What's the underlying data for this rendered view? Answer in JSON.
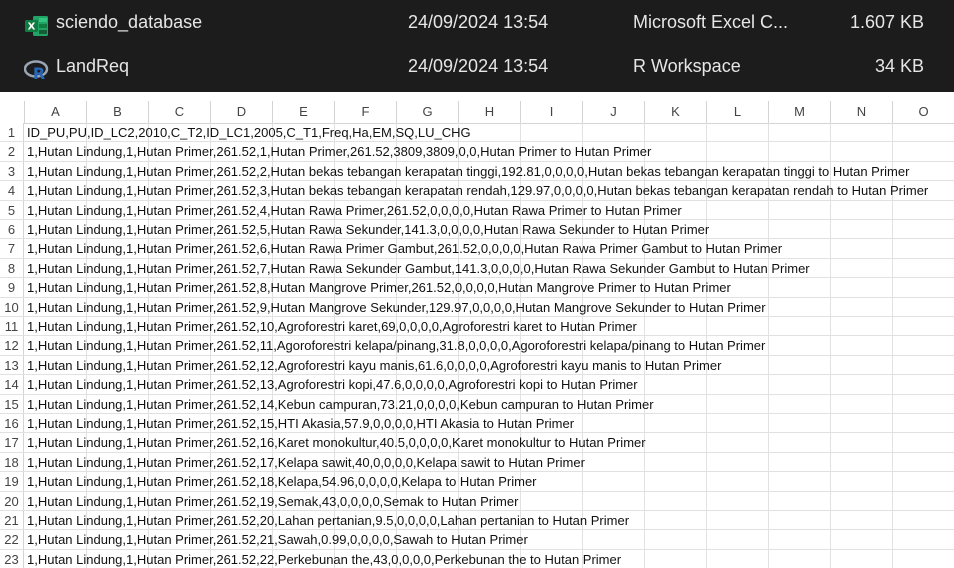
{
  "explorer": {
    "files": [
      {
        "icon": "excel-icon",
        "name": "sciendo_database",
        "date": "24/09/2024 13:54",
        "type": "Microsoft Excel C...",
        "size": "1.607 KB"
      },
      {
        "icon": "r-workspace-icon",
        "name": "LandReq",
        "date": "24/09/2024 13:54",
        "type": "R Workspace",
        "size": "34 KB"
      }
    ]
  },
  "sheet": {
    "columns": [
      "A",
      "B",
      "C",
      "D",
      "E",
      "F",
      "G",
      "H",
      "I",
      "J",
      "K",
      "L",
      "M",
      "N",
      "O"
    ],
    "rows": [
      {
        "num": "1",
        "text": "ID_PU,PU,ID_LC2,2010,C_T2,ID_LC1,2005,C_T1,Freq,Ha,EM,SQ,LU_CHG"
      },
      {
        "num": "2",
        "text": "1,Hutan Lindung,1,Hutan Primer,261.52,1,Hutan Primer,261.52,3809,3809,0,0,Hutan Primer to Hutan Primer"
      },
      {
        "num": "3",
        "text": "1,Hutan Lindung,1,Hutan Primer,261.52,2,Hutan bekas tebangan kerapatan tinggi,192.81,0,0,0,0,Hutan bekas tebangan kerapatan tinggi to Hutan Primer"
      },
      {
        "num": "4",
        "text": "1,Hutan Lindung,1,Hutan Primer,261.52,3,Hutan bekas tebangan kerapatan rendah,129.97,0,0,0,0,Hutan bekas tebangan kerapatan rendah to Hutan Primer"
      },
      {
        "num": "5",
        "text": "1,Hutan Lindung,1,Hutan Primer,261.52,4,Hutan Rawa Primer,261.52,0,0,0,0,Hutan Rawa Primer to Hutan Primer"
      },
      {
        "num": "6",
        "text": "1,Hutan Lindung,1,Hutan Primer,261.52,5,Hutan Rawa Sekunder,141.3,0,0,0,0,Hutan Rawa Sekunder to Hutan Primer"
      },
      {
        "num": "7",
        "text": "1,Hutan Lindung,1,Hutan Primer,261.52,6,Hutan Rawa Primer Gambut,261.52,0,0,0,0,Hutan Rawa Primer Gambut to Hutan Primer"
      },
      {
        "num": "8",
        "text": "1,Hutan Lindung,1,Hutan Primer,261.52,7,Hutan Rawa Sekunder Gambut,141.3,0,0,0,0,Hutan Rawa Sekunder Gambut to Hutan Primer"
      },
      {
        "num": "9",
        "text": "1,Hutan Lindung,1,Hutan Primer,261.52,8,Hutan Mangrove Primer,261.52,0,0,0,0,Hutan Mangrove Primer to Hutan Primer"
      },
      {
        "num": "10",
        "text": "1,Hutan Lindung,1,Hutan Primer,261.52,9,Hutan Mangrove Sekunder,129.97,0,0,0,0,Hutan Mangrove Sekunder to Hutan Primer"
      },
      {
        "num": "11",
        "text": "1,Hutan Lindung,1,Hutan Primer,261.52,10,Agroforestri karet,69,0,0,0,0,Agroforestri karet to Hutan Primer"
      },
      {
        "num": "12",
        "text": "1,Hutan Lindung,1,Hutan Primer,261.52,11,Agoroforestri kelapa/pinang,31.8,0,0,0,0,Agoroforestri kelapa/pinang to Hutan Primer"
      },
      {
        "num": "13",
        "text": "1,Hutan Lindung,1,Hutan Primer,261.52,12,Agroforestri kayu manis,61.6,0,0,0,0,Agroforestri kayu manis to Hutan Primer"
      },
      {
        "num": "14",
        "text": "1,Hutan Lindung,1,Hutan Primer,261.52,13,Agroforestri kopi,47.6,0,0,0,0,Agroforestri kopi to Hutan Primer"
      },
      {
        "num": "15",
        "text": "1,Hutan Lindung,1,Hutan Primer,261.52,14,Kebun campuran,73.21,0,0,0,0,Kebun campuran to Hutan Primer"
      },
      {
        "num": "16",
        "text": "1,Hutan Lindung,1,Hutan Primer,261.52,15,HTI Akasia,57.9,0,0,0,0,HTI Akasia to Hutan Primer"
      },
      {
        "num": "17",
        "text": "1,Hutan Lindung,1,Hutan Primer,261.52,16,Karet monokultur,40.5,0,0,0,0,Karet monokultur to Hutan Primer"
      },
      {
        "num": "18",
        "text": "1,Hutan Lindung,1,Hutan Primer,261.52,17,Kelapa sawit,40,0,0,0,0,Kelapa sawit to Hutan Primer"
      },
      {
        "num": "19",
        "text": "1,Hutan Lindung,1,Hutan Primer,261.52,18,Kelapa,54.96,0,0,0,0,Kelapa to Hutan Primer"
      },
      {
        "num": "20",
        "text": "1,Hutan Lindung,1,Hutan Primer,261.52,19,Semak,43,0,0,0,0,Semak to Hutan Primer"
      },
      {
        "num": "21",
        "text": "1,Hutan Lindung,1,Hutan Primer,261.52,20,Lahan pertanian,9.5,0,0,0,0,Lahan pertanian to Hutan Primer"
      },
      {
        "num": "22",
        "text": "1,Hutan Lindung,1,Hutan Primer,261.52,21,Sawah,0.99,0,0,0,0,Sawah to Hutan Primer"
      },
      {
        "num": "23",
        "text": "1,Hutan Lindung,1,Hutan Primer,261.52,22,Perkebunan the,43,0,0,0,0,Perkebunan the to Hutan Primer"
      }
    ]
  }
}
